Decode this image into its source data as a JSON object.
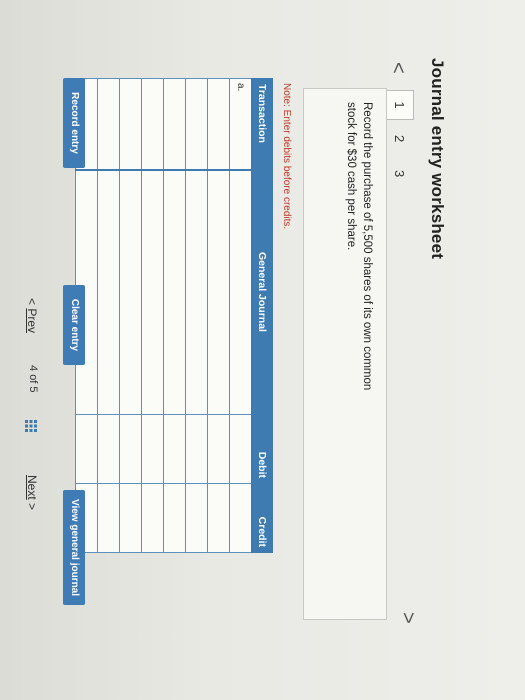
{
  "worksheet": {
    "title": "Journal entry worksheet",
    "steps": [
      "1",
      "2",
      "3"
    ],
    "prev_arrow": "<",
    "next_arrow": ">",
    "instruction": "Record the purchase of 5,500 shares of its own common stock for $30 cash per share.",
    "note": "Note: Enter debits before credits."
  },
  "table": {
    "headers": [
      "Transaction",
      "General Journal",
      "Debit",
      "Credit"
    ],
    "rows": [
      [
        "a.",
        "",
        "",
        ""
      ],
      [
        "",
        "",
        "",
        ""
      ],
      [
        "",
        "",
        "",
        ""
      ],
      [
        "",
        "",
        "",
        ""
      ],
      [
        "",
        "",
        "",
        ""
      ],
      [
        "",
        "",
        "",
        ""
      ],
      [
        "",
        "",
        "",
        ""
      ],
      [
        "",
        "",
        "",
        ""
      ]
    ]
  },
  "buttons": {
    "record": "Record entry",
    "clear": "Clear entry",
    "view": "View general journal"
  },
  "pager": {
    "prev_icon": "<",
    "prev": "Prev",
    "current": "4",
    "of": "of 5",
    "next": "Next",
    "next_icon": ">"
  },
  "colors": {
    "accent": "#3d7bb0",
    "note": "#c0392b"
  }
}
